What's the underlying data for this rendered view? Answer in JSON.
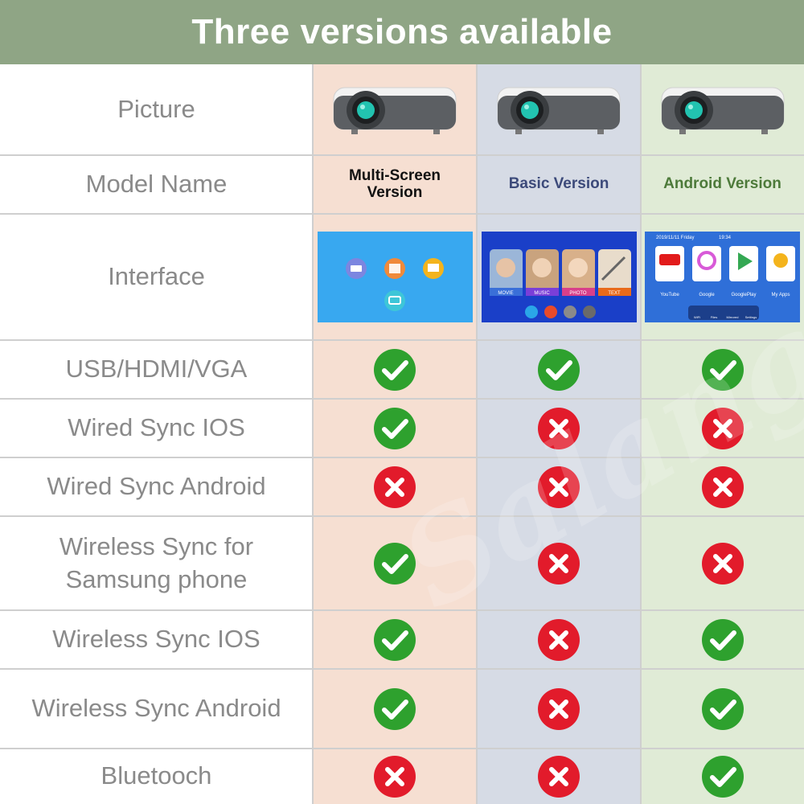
{
  "title": "Three versions available",
  "watermark_text": "Salange",
  "colors": {
    "banner": "#8fa585",
    "multi_bg": "#f6dfd2",
    "basic_bg": "#d6dbe5",
    "android_bg": "#e0ebd6",
    "check_green": "#2ea12e",
    "cross_red": "#e21b2b"
  },
  "columns": [
    {
      "model_name": "Multi-Screen Version",
      "model_line1": "Multi-Screen",
      "model_line2": "Version"
    },
    {
      "model_name": "Basic Version"
    },
    {
      "model_name": "Android Version"
    }
  ],
  "row_labels": {
    "picture": "Picture",
    "model_name": "Model Name",
    "interface": "Interface"
  },
  "interfaces": {
    "basic": {
      "tiles": [
        "MOVIE",
        "MUSIC",
        "PHOTO",
        "TEXT"
      ]
    },
    "android": {
      "status_date": "2019/11/11 Friday",
      "status_time": "19:34",
      "apps": [
        "YouTube",
        "Google",
        "GooglePlay",
        "My Apps"
      ],
      "dock": [
        "WiFi",
        "Files",
        "Mirrored",
        "Settings"
      ]
    }
  },
  "features": [
    {
      "label": "USB/HDMI/VGA",
      "values": [
        "check",
        "check",
        "check"
      ]
    },
    {
      "label": "Wired Sync IOS",
      "values": [
        "check",
        "cross",
        "cross"
      ]
    },
    {
      "label": "Wired Sync Android",
      "values": [
        "cross",
        "cross",
        "cross"
      ]
    },
    {
      "label_line1": "Wireless Sync for",
      "label_line2": "Samsung phone",
      "values": [
        "check",
        "cross",
        "cross"
      ]
    },
    {
      "label": "Wireless Sync IOS",
      "values": [
        "check",
        "cross",
        "check"
      ]
    },
    {
      "label": "Wireless Sync Android",
      "values": [
        "check",
        "cross",
        "check"
      ]
    },
    {
      "label": "Bluetooch",
      "values": [
        "cross",
        "cross",
        "check"
      ]
    }
  ]
}
